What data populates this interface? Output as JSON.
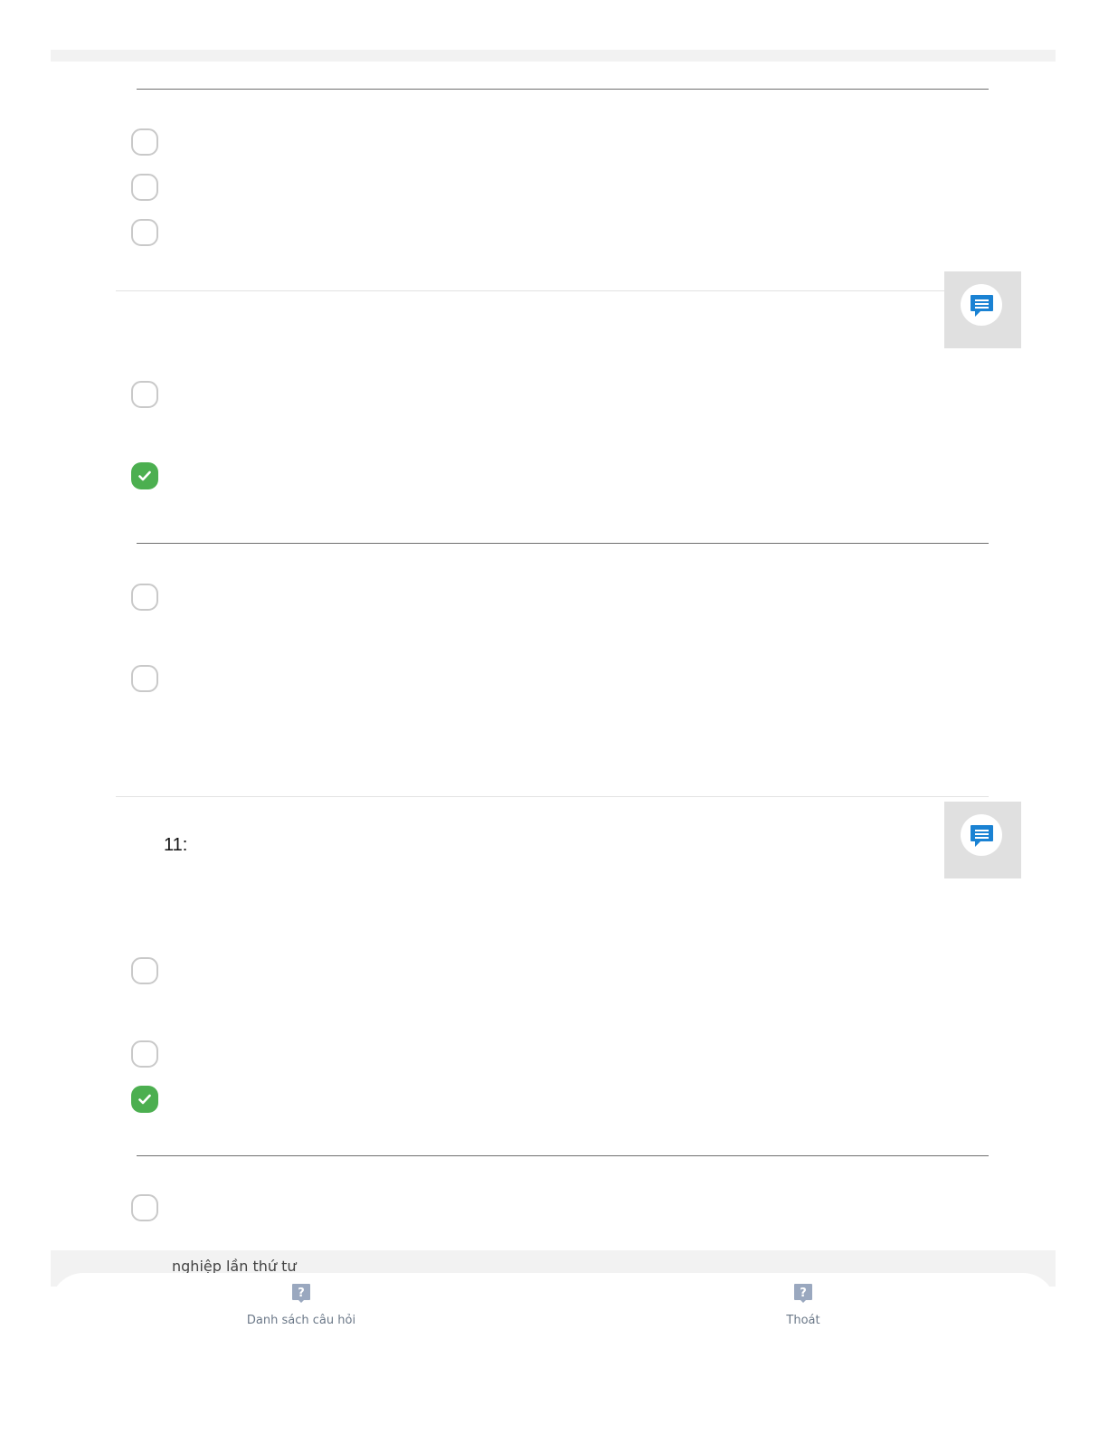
{
  "question": {
    "label": "11:"
  },
  "footer_text": "nghiệp lần thứ tư",
  "bottom_nav": {
    "list_label": "Danh sách câu hỏi",
    "exit_label": "Thoát",
    "icon": "question-help-icon"
  },
  "options": [
    {
      "state": "unselected"
    },
    {
      "state": "unselected"
    },
    {
      "state": "unselected"
    },
    {
      "state": "unselected"
    },
    {
      "state": "selected"
    },
    {
      "state": "unselected"
    },
    {
      "state": "unselected"
    },
    {
      "state": "unselected"
    },
    {
      "state": "unselected"
    },
    {
      "state": "selected"
    },
    {
      "state": "unselected"
    }
  ],
  "colors": {
    "selected": "#4caf50",
    "comment_icon": "#1a82d3",
    "nav_icon": "#9aa8bf",
    "nav_text": "#6b7888"
  },
  "icons": {
    "comment": "comment-icon",
    "check": "check-icon"
  }
}
